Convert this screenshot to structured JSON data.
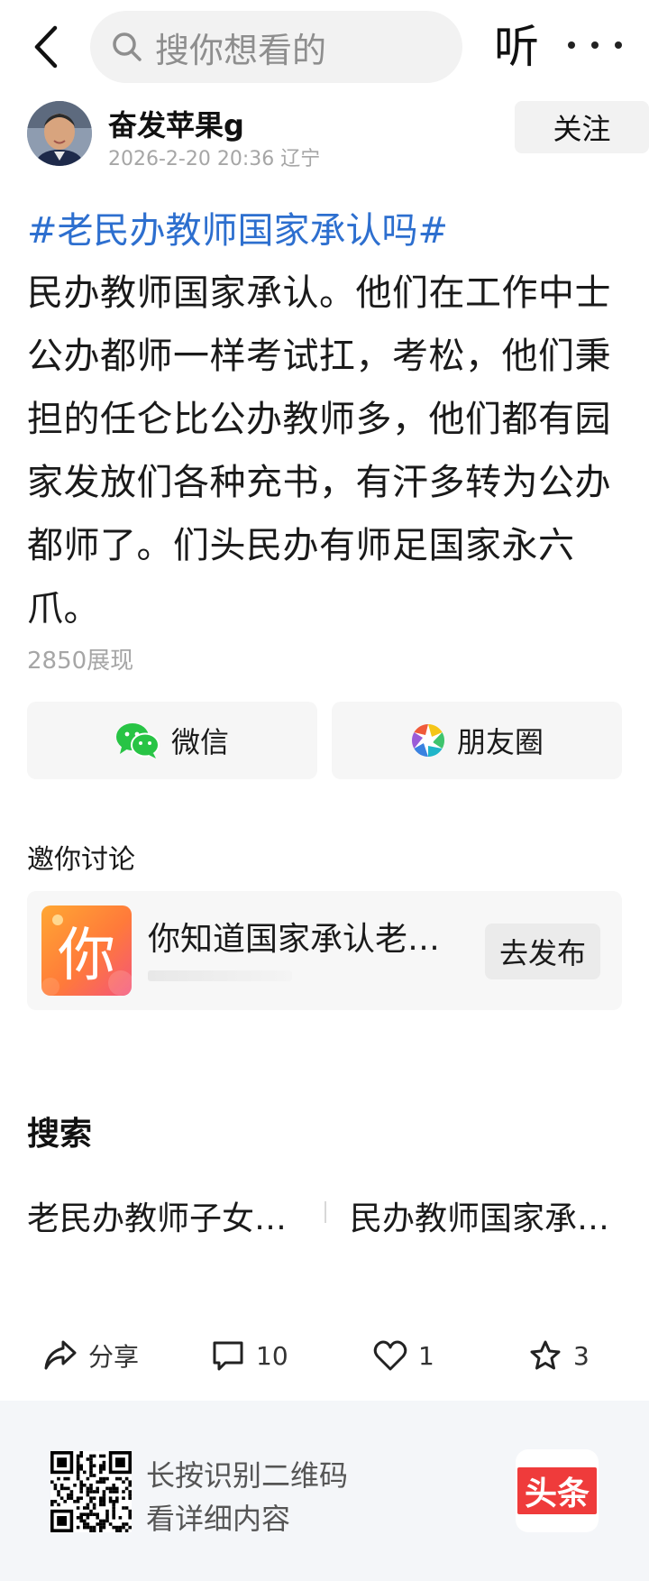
{
  "topbar": {
    "search_placeholder": "搜你想看的",
    "listen_label": "听"
  },
  "author": {
    "name": "奋发苹果g",
    "meta": "2026-2-20 20:36 辽宁",
    "follow_label": "关注"
  },
  "post": {
    "hashtag": "#老民办教师国家承认吗#",
    "content": "民办教师国家承认。他们在工作中士公办都师一样考试扛，考松，他们秉担的任仑比公办教师多，他们都有园家发放们各种充书，有汗多转为公办都师了。们头民办有师足国家永六爪。",
    "views": "2850展现"
  },
  "share": {
    "wechat_label": "微信",
    "moments_label": "朋友圈"
  },
  "invite": {
    "title": "邀你讨论",
    "thumb_char": "你",
    "text": "你知道国家承认老…",
    "publish_label": "去发布"
  },
  "search_section": {
    "title": "搜索",
    "items": [
      "老民办教师子女…",
      "民办教师国家承…"
    ]
  },
  "actions": {
    "share_label": "分享",
    "comment_count": "10",
    "like_count": "1",
    "fav_count": "3"
  },
  "footer": {
    "line1": "长按识别二维码",
    "line2": "看详细内容",
    "logo_text": "头条"
  },
  "colors": {
    "link_blue": "#2d6fcf",
    "wechat_green": "#28c445",
    "logo_red": "#ef3b3b",
    "thumb_orange": "#ff8a33"
  }
}
